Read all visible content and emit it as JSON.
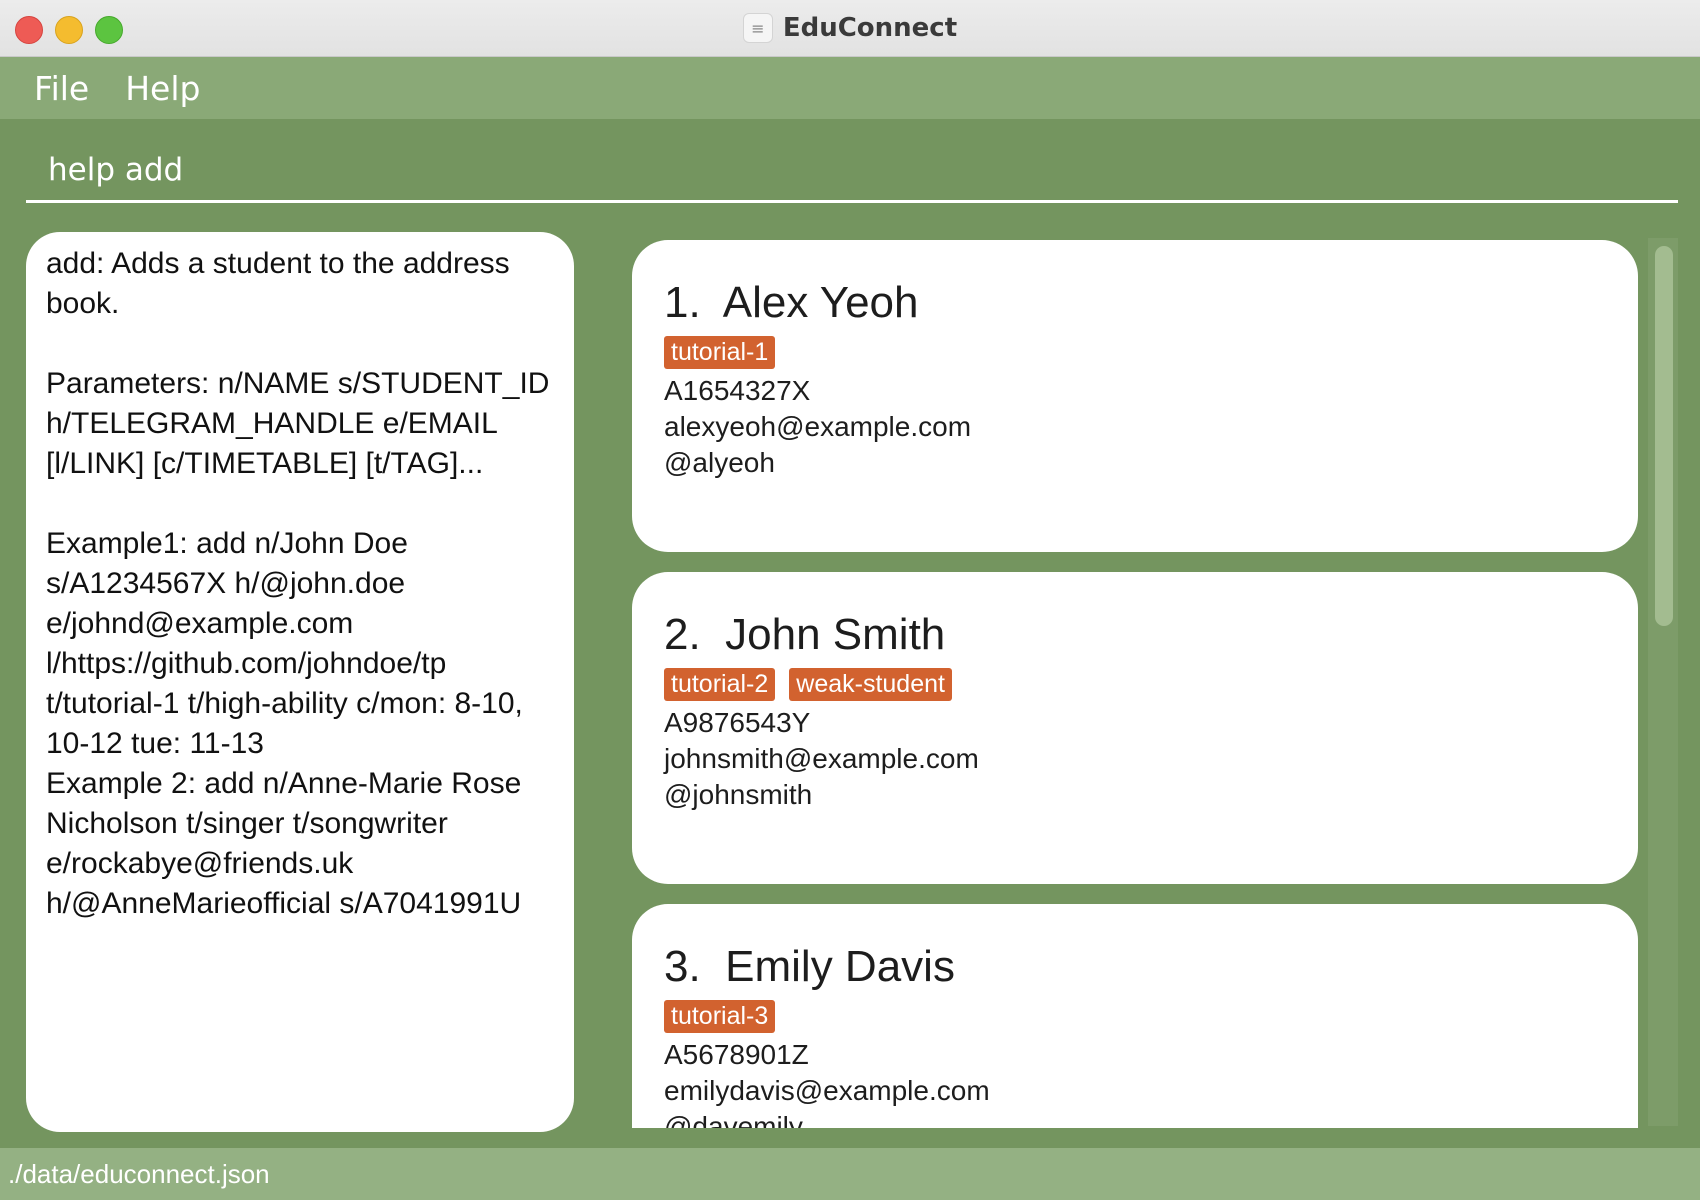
{
  "window": {
    "title": "EduConnect",
    "icon": "app-icon"
  },
  "menu": {
    "items": [
      "File",
      "Help"
    ]
  },
  "command": {
    "value": "help add"
  },
  "result": {
    "text": "add: Adds a student to the address book.\n\nParameters: n/NAME s/STUDENT_ID h/TELEGRAM_HANDLE e/EMAIL [l/LINK] [c/TIMETABLE] [t/TAG]...\n\nExample1: add n/John Doe s/A1234567X h/@john.doe e/johnd@example.com l/https://github.com/johndoe/tp t/tutorial-1 t/high-ability c/mon: 8-10, 10-12 tue: 11-13\nExample 2: add n/Anne-Marie Rose Nicholson t/singer t/songwriter e/rockabye@friends.uk h/@AnneMarieofficial s/A7041991U"
  },
  "persons": [
    {
      "index": "1.",
      "name": "Alex Yeoh",
      "tags": [
        "tutorial-1"
      ],
      "student_id": "A1654327X",
      "email": "alexyeoh@example.com",
      "telegram": "@alyeoh"
    },
    {
      "index": "2.",
      "name": "John Smith",
      "tags": [
        "tutorial-2",
        "weak-student"
      ],
      "student_id": "A9876543Y",
      "email": "johnsmith@example.com",
      "telegram": "@johnsmith"
    },
    {
      "index": "3.",
      "name": "Emily Davis",
      "tags": [
        "tutorial-3"
      ],
      "student_id": "A5678901Z",
      "email": "emilydavis@example.com",
      "telegram": "@davemily"
    }
  ],
  "status": {
    "file_path": "./data/educonnect.json"
  },
  "colors": {
    "background": "#74955f",
    "menubar": "#8aa977",
    "statusbar": "#94b183",
    "tag": "#d2622f"
  }
}
